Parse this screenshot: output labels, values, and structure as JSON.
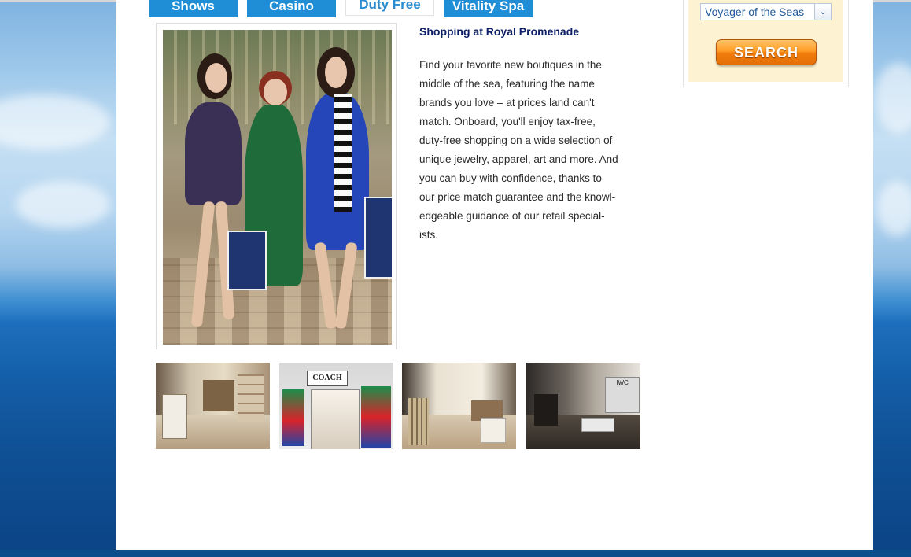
{
  "tabs": [
    {
      "label": "Shows",
      "active": false
    },
    {
      "label": "Casino",
      "active": false
    },
    {
      "label": "Duty Free",
      "active": true
    },
    {
      "label": "Vitality Spa",
      "active": false
    }
  ],
  "article": {
    "headline": "Shopping at Royal Promenade",
    "body_lines": [
      "Find your favorite new boutiques in the",
      "middle of the sea, featuring the name",
      "brands you love – at prices land can't",
      "match. Onboard, you'll enjoy tax-free,",
      "duty-free shopping on a wide selection of",
      "unique jewelry, apparel, art and more. And",
      "you can buy with confidence, thanks to",
      "our price match guarantee and the knowl-",
      "edgeable guidance of our retail special-",
      "ists."
    ]
  },
  "thumbnails": [
    {
      "name": "burberry-store"
    },
    {
      "name": "coach-store",
      "sign": "COACH"
    },
    {
      "name": "michael-kors-store"
    },
    {
      "name": "iwc-store",
      "sign": "IWC"
    }
  ],
  "search_panel": {
    "ship_selected": "Voyager of the Seas",
    "search_label": "SEARCH"
  },
  "colors": {
    "tab_blue": "#1f8ed6",
    "headline_navy": "#0d1f66",
    "search_orange": "#f07d0c",
    "panel_cream": "#fdf3d2"
  }
}
